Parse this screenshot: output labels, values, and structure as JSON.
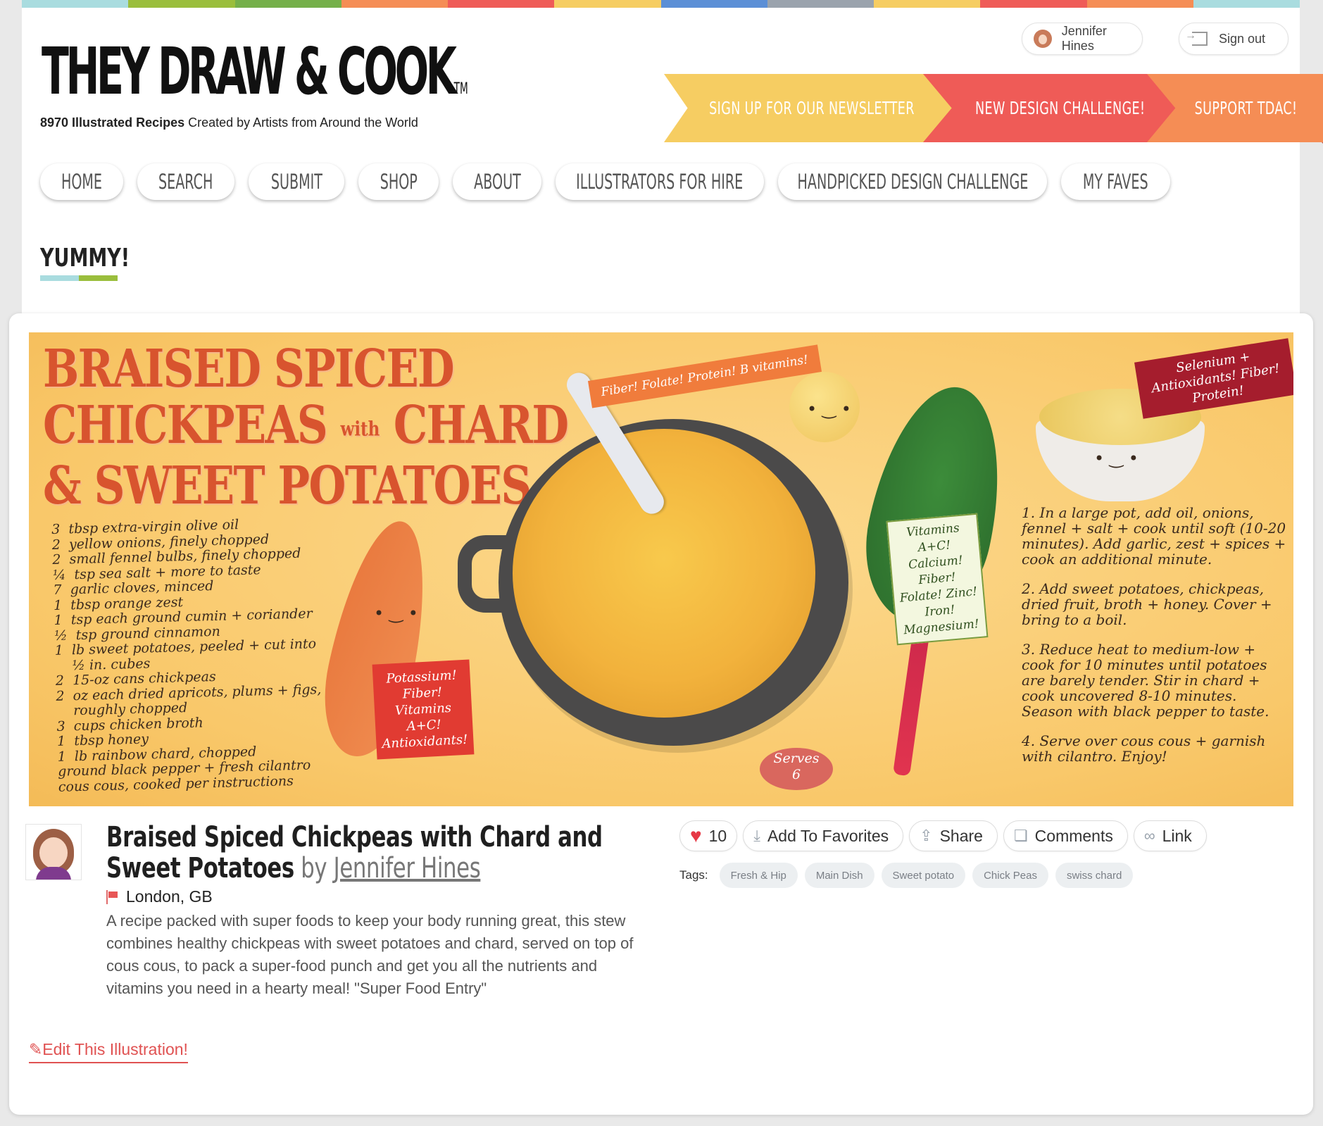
{
  "site": {
    "logo_text": "THEY DRAW & COOK",
    "logo_tm": "TM",
    "tagline_count": "8970 Illustrated Recipes",
    "tagline_rest": " Created by Artists from Around the World",
    "stripe_colors": [
      "#a9dcdf",
      "#9abe3c",
      "#75b04a",
      "#f58d55",
      "#ef5b57",
      "#f6cd62",
      "#5b8fd6",
      "#9aa3ad",
      "#f6cd62",
      "#ef5b57",
      "#f58d55",
      "#a9dcdf"
    ]
  },
  "user": {
    "name": "Jennifer Hines",
    "signout_label": "Sign out"
  },
  "banners": {
    "newsletter": "SIGN UP FOR OUR NEWSLETTER",
    "challenge": "NEW DESIGN CHALLENGE!",
    "support": "SUPPORT TDAC!"
  },
  "nav": {
    "home": "HOME",
    "search": "SEARCH",
    "submit": "SUBMIT",
    "shop": "SHOP",
    "about": "ABOUT",
    "illustrators": "ILLUSTRATORS FOR HIRE",
    "handpicked": "HANDPICKED DESIGN CHALLENGE",
    "faves": "MY FAVES"
  },
  "section": {
    "title": "YUMMY!"
  },
  "illustration": {
    "title_line1": "BRAISED SPICED",
    "title_line2a": "CHICKPEAS ",
    "title_with": "with",
    "title_line2b": " CHARD",
    "title_line3": "& SWEET POTATOES",
    "ingredients": "3  tbsp extra-virgin olive oil\n2  yellow onions, finely chopped\n2  small fennel bulbs, finely chopped\n¼  tsp sea salt + more to taste\n7  garlic cloves, minced\n1  tbsp orange zest\n1  tsp each ground cumin + coriander\n½  tsp ground cinnamon\n1  lb sweet potatoes, peeled + cut into\n    ½ in. cubes\n2  15-oz cans chickpeas\n2  oz each dried apricots, plums + figs,\n    roughly chopped\n3  cups chicken broth\n1  tbsp honey\n1  lb rainbow chard, chopped\nground black pepper + fresh cilantro\ncous cous, cooked per instructions",
    "steps": [
      "1. In a large pot, add oil, onions, fennel + salt + cook until soft (10-20 minutes). Add garlic, zest + spices + cook an additional minute.",
      "2. Add sweet potatoes, chickpeas, dried fruit, broth + honey. Cover + bring to a boil.",
      "3. Reduce heat to medium-low + cook for 10 minutes until potatoes are barely tender. Stir in chard + cook uncovered 8-10 minutes. Season with black pepper to taste.",
      "4. Serve over cous cous + garnish with cilantro. Enjoy!"
    ],
    "flag_chickpea": "Fiber! Folate! Protein! B vitamins!",
    "flag_couscous": "Selenium + Antioxidants! Fiber! Protein!",
    "note_chard": "Vitamins A+C! Calcium! Fiber! Folate! Zinc! Iron! Magnesium!",
    "note_potato": "Potassium! Fiber! Vitamins A+C! Antioxidants!",
    "serves_label": "Serves",
    "serves_value": "6"
  },
  "recipe": {
    "title": "Braised Spiced Chickpeas with Chard and Sweet Potatoes",
    "by": " by ",
    "author": "Jennifer Hines",
    "location": "London, GB",
    "description": "A recipe packed with super foods to keep your body running great, this stew combines healthy chickpeas with sweet potatoes and chard, served on top of cous cous, to pack a super-food punch and get you all the nutrients and vitamins you need in a hearty meal! \"Super Food Entry\"",
    "edit_label": "Edit This Illustration!"
  },
  "actions": {
    "likes": "10",
    "favorites": "Add To Favorites",
    "share": "Share",
    "comments": "Comments",
    "link": "Link"
  },
  "tags": {
    "label": "Tags:",
    "items": [
      "Fresh & Hip",
      "Main Dish",
      "Sweet potato",
      "Chick Peas",
      "swiss chard"
    ]
  }
}
